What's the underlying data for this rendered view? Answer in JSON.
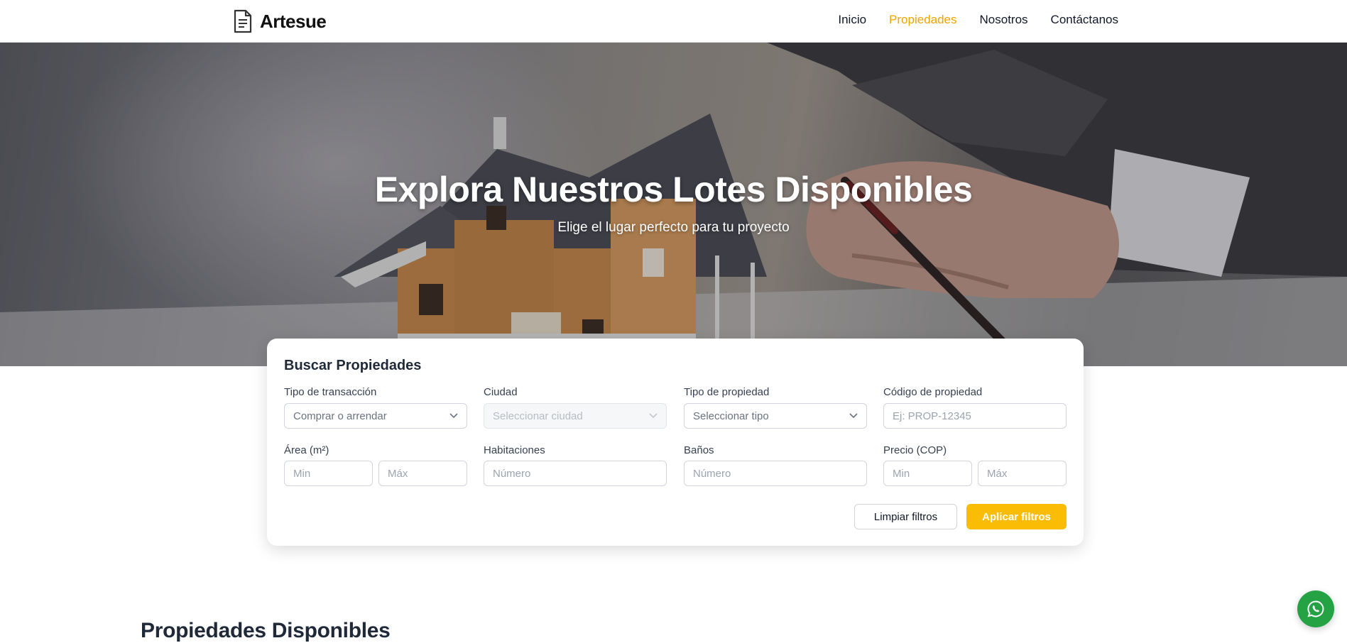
{
  "brand": {
    "name": "Artesue",
    "icon": "document-icon"
  },
  "nav": {
    "items": [
      {
        "label": "Inicio",
        "active": false
      },
      {
        "label": "Propiedades",
        "active": true
      },
      {
        "label": "Nosotros",
        "active": false
      },
      {
        "label": "Contáctanos",
        "active": false
      }
    ]
  },
  "hero": {
    "title": "Explora Nuestros Lotes Disponibles",
    "subtitle": "Elige el lugar perfecto para tu proyecto",
    "background": "house-model-and-signing-hand-photo"
  },
  "search": {
    "title": "Buscar Propiedades",
    "transaction": {
      "label": "Tipo de transacción",
      "value": "Comprar o arrendar"
    },
    "city": {
      "label": "Ciudad",
      "value": "Seleccionar ciudad",
      "disabled": true
    },
    "property_type": {
      "label": "Tipo de propiedad",
      "value": "Seleccionar tipo"
    },
    "code": {
      "label": "Código de propiedad",
      "placeholder": "Ej: PROP-12345"
    },
    "area": {
      "label": "Área (m²)",
      "min_placeholder": "Min",
      "max_placeholder": "Máx"
    },
    "rooms": {
      "label": "Habitaciones",
      "placeholder": "Número"
    },
    "baths": {
      "label": "Baños",
      "placeholder": "Número"
    },
    "price": {
      "label": "Precio (COP)",
      "min_placeholder": "Min",
      "max_placeholder": "Máx"
    },
    "clear_label": "Limpiar filtros",
    "apply_label": "Aplicar filtros"
  },
  "listing": {
    "title": "Propiedades Disponibles"
  },
  "floating": {
    "icon": "whatsapp-icon"
  },
  "colors": {
    "accent": "#fbbc05",
    "nav_active": "#f0a500",
    "whatsapp": "#25a244",
    "text": "#1f2937"
  }
}
